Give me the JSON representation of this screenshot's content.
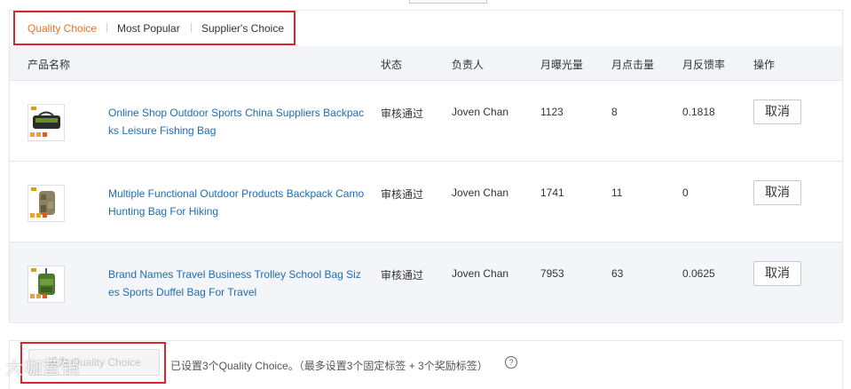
{
  "tabs": [
    {
      "label": "Quality Choice",
      "active": true
    },
    {
      "label": "Most Popular",
      "active": false
    },
    {
      "label": "Supplier's Choice",
      "active": false
    }
  ],
  "table": {
    "headers": {
      "name": "产品名称",
      "status": "状态",
      "owner": "负责人",
      "impressions": "月曝光量",
      "clicks": "月点击量",
      "feedback": "月反馈率",
      "action": "操作"
    },
    "rows": [
      {
        "name": "Online Shop Outdoor Sports China Suppliers Backpacks Leisure Fishing Bag",
        "status": "审核通过",
        "owner": "Joven Chan",
        "impressions": "1123",
        "clicks": "8",
        "feedback": "0.1818",
        "action": "取消",
        "thumb_icon": "fishing-bag-icon"
      },
      {
        "name": "Multiple Functional Outdoor Products Backpack Camo Hunting Bag For Hiking",
        "status": "审核通过",
        "owner": "Joven Chan",
        "impressions": "1741",
        "clicks": "11",
        "feedback": "0",
        "action": "取消",
        "thumb_icon": "camo-backpack-icon"
      },
      {
        "name": "Brand Names Travel Business Trolley School Bag Sizes Sports Duffel Bag For Travel",
        "status": "审核通过",
        "owner": "Joven Chan",
        "impressions": "7953",
        "clicks": "63",
        "feedback": "0.0625",
        "action": "取消",
        "thumb_icon": "trolley-bag-icon"
      }
    ]
  },
  "footer": {
    "set_button": "设为 Quality Choice",
    "info_text": "已设置3个Quality Choice。（最多设置3个固定标签 + 3个奖励标签）",
    "help_glyph": "?"
  },
  "watermark": "大咖营销",
  "colors": {
    "accent_orange": "#f26f21",
    "link_blue": "#1e6cb5",
    "annotation_red": "#d9262b"
  }
}
